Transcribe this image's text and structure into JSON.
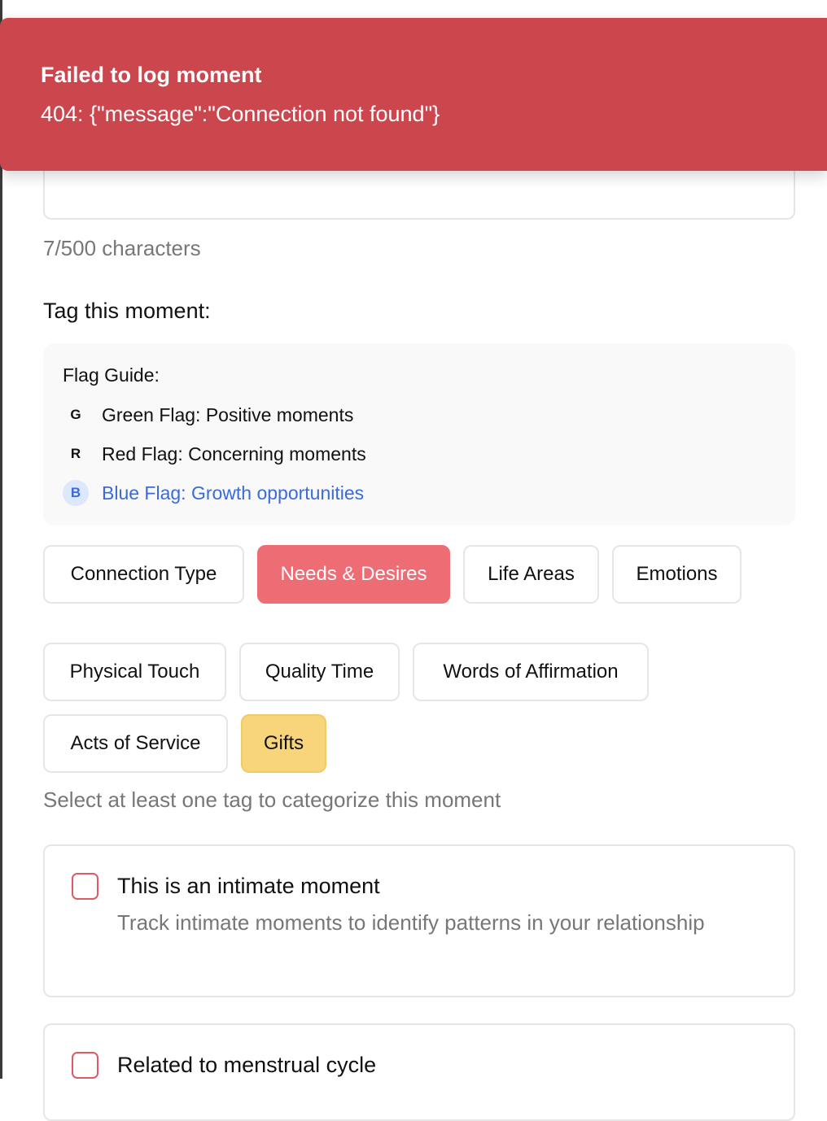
{
  "toast": {
    "title": "Failed to log moment",
    "message": "404: {\"message\":\"Connection not found\"}"
  },
  "note": {
    "char_count": "7/500 characters"
  },
  "tags": {
    "heading": "Tag this moment:",
    "flag_guide": {
      "title": "Flag Guide:",
      "items": [
        {
          "letter": "G",
          "label": "Green Flag: Positive moments"
        },
        {
          "letter": "R",
          "label": "Red Flag: Concerning moments"
        },
        {
          "letter": "B",
          "label": "Blue Flag: Growth opportunities"
        }
      ]
    },
    "categories": [
      "Connection Type",
      "Needs & Desires",
      "Life Areas",
      "Emotions"
    ],
    "selected_category": "Needs & Desires",
    "options": [
      "Physical Touch",
      "Quality Time",
      "Words of Affirmation",
      "Acts of Service",
      "Gifts"
    ],
    "selected_option": "Gifts",
    "helper": "Select at least one tag to categorize this moment"
  },
  "intimate": {
    "title": "This is an intimate moment",
    "description": "Track intimate moments to identify patterns in your relationship",
    "checked": false
  },
  "menstrual": {
    "title": "Related to menstrual cycle",
    "checked": false
  },
  "colors": {
    "toast_bg": "#cc464d",
    "active_category": "#ee6d75",
    "active_tag": "#f8d57a",
    "blue_flag": "#3a6bd8",
    "checkbox_border": "#e05a64"
  }
}
